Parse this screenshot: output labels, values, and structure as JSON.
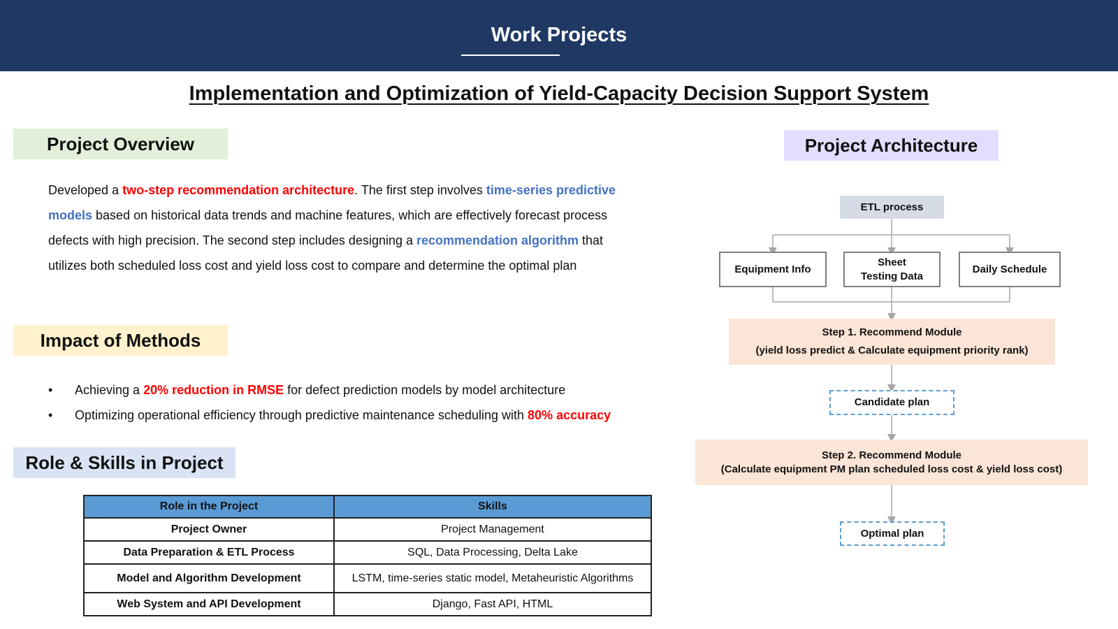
{
  "header": {
    "title": "Work Projects"
  },
  "main_title": "Implementation and Optimization of Yield-Capacity Decision Support System",
  "overview": {
    "label": "Project Overview",
    "p1": "Developed a ",
    "h1": "two-step recommendation architecture",
    "p2": ". The first step involves ",
    "h2": "time-series predictive models",
    "p3": " based on historical data trends and machine features, which are effectively forecast process defects with high precision. The second step includes designing a ",
    "h3": "recommendation algorithm",
    "p4": " that utilizes both scheduled loss cost and yield loss cost to compare and determine the optimal plan"
  },
  "impact": {
    "label": "Impact of Methods",
    "bullet_char": "•",
    "b1_pre": "Achieving a ",
    "b1_hl": "20% reduction in RMSE",
    "b1_post": " for defect prediction models by model architecture",
    "b2_pre": "Optimizing operational efficiency through predictive maintenance scheduling with ",
    "b2_hl": "80% accuracy"
  },
  "role": {
    "label": "Role & Skills in Project",
    "headers": [
      "Role in the Project",
      "Skills"
    ],
    "rows": [
      [
        "Project Owner",
        "Project Management"
      ],
      [
        "Data Preparation & ETL Process",
        "SQL, Data Processing, Delta Lake"
      ],
      [
        "Model and Algorithm Development",
        "LSTM, time-series static model, Metaheuristic Algorithms"
      ],
      [
        "Web System and API Development",
        "Django, Fast API, HTML"
      ]
    ]
  },
  "architecture": {
    "label": "Project Architecture",
    "etl": "ETL process",
    "sources": [
      "Equipment Info",
      "Sheet\nTesting Data",
      "Daily Schedule"
    ],
    "step1_line1": "Step 1. Recommend Module",
    "step1_line2": "(yield loss predict & Calculate equipment priority rank)",
    "candidate": "Candidate plan",
    "step2_line1": "Step 2. Recommend Module",
    "step2_line2": "(Calculate equipment PM plan scheduled loss cost & yield loss cost)",
    "optimal": "Optimal plan"
  },
  "colors": {
    "header_bg": "#203864",
    "overview_bg": "#e2efda",
    "impact_bg": "#fff2cc",
    "role_bg": "#dae3f3",
    "arch_bg": "#e5ddfd",
    "highlight_red": "#ff0000",
    "highlight_blue": "#4472c4",
    "table_header": "#5b9bd5",
    "step_bg": "#fbe5d6",
    "etl_bg": "#d6dce5"
  }
}
